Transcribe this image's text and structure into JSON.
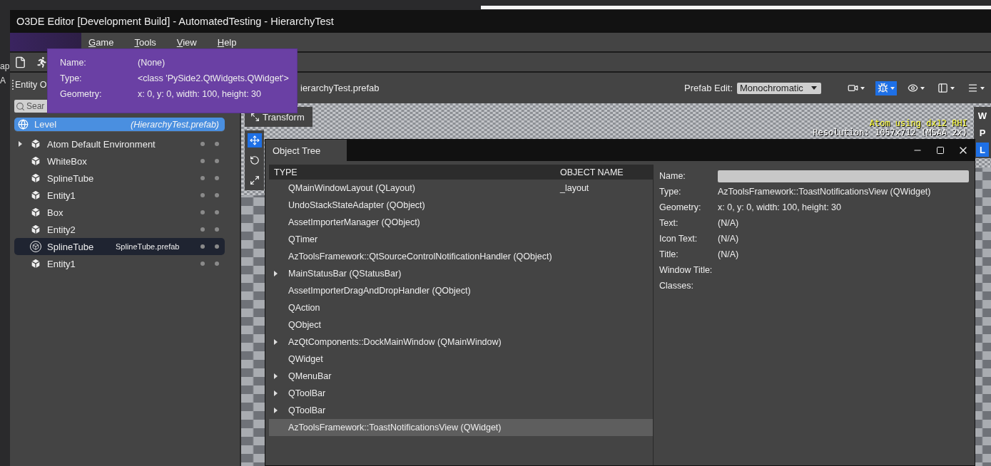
{
  "outside": {
    "fragments": [
      "ap",
      "A"
    ]
  },
  "window": {
    "title": "O3DE Editor [Development Build] - AutomatedTesting - HierarchyTest"
  },
  "menu": [
    {
      "label": "Game"
    },
    {
      "label": "Tools"
    },
    {
      "label": "View"
    },
    {
      "label": "Help"
    }
  ],
  "toolbar": [
    {
      "kind": "file"
    },
    {
      "kind": "run"
    }
  ],
  "tooltip": {
    "rows": [
      {
        "label": "Name:",
        "value": "(None)"
      },
      {
        "label": "Type:",
        "value": "<class 'PySide2.QtWidgets.QWidget'>"
      },
      {
        "label": "Geometry:",
        "value": "x: 0, y: 0, width: 100, height: 30"
      }
    ]
  },
  "outliner": {
    "title": "Entity O",
    "search": {
      "placeholder": "Sear"
    },
    "level": {
      "name": "Level",
      "prefab": "(HierarchyTest.prefab)",
      "selected": true
    },
    "entities": [
      {
        "name": "Atom Default Environment",
        "kind": "entity",
        "expandable": true,
        "highlighted": false
      },
      {
        "name": "WhiteBox",
        "kind": "entity",
        "expandable": false,
        "highlighted": false
      },
      {
        "name": "SplineTube",
        "kind": "entity",
        "expandable": false,
        "highlighted": false
      },
      {
        "name": "Entity1",
        "kind": "entity",
        "expandable": false,
        "highlighted": false
      },
      {
        "name": "Box",
        "kind": "entity",
        "expandable": false,
        "highlighted": false
      },
      {
        "name": "Entity2",
        "kind": "entity",
        "expandable": false,
        "highlighted": false
      },
      {
        "name": "SplineTube",
        "kind": "prefab",
        "prefab": "SplineTube.prefab",
        "expandable": false,
        "highlighted": true
      },
      {
        "name": "Entity1",
        "kind": "entity",
        "expandable": false,
        "highlighted": false
      }
    ]
  },
  "viewport": {
    "tab_title": "ierarchyTest.prefab",
    "prefab_edit": {
      "label": "Prefab Edit:",
      "value": "Monochromatic"
    },
    "toolbar": [
      {
        "kind": "camera",
        "active": false
      },
      {
        "kind": "debug",
        "active": true
      },
      {
        "kind": "visibility",
        "active": false
      },
      {
        "kind": "layout",
        "active": false
      },
      {
        "kind": "menu",
        "active": false
      }
    ],
    "transform_button": "Transform",
    "tools": [
      {
        "kind": "move",
        "selected": true
      },
      {
        "kind": "rotate",
        "selected": false
      },
      {
        "kind": "scale",
        "selected": false
      }
    ],
    "overlay": {
      "renderer": "Atom using dx12 RHI",
      "resolution": "Resolution: 1057x712 (MSAA 2x)"
    },
    "side_buttons": [
      {
        "label": "W",
        "selected": false
      },
      {
        "label": "P",
        "selected": false
      },
      {
        "label": "L",
        "selected": true
      }
    ]
  },
  "object_tree": {
    "title": "Object Tree",
    "columns": [
      "TYPE",
      "OBJECT NAME"
    ],
    "rows": [
      {
        "type": "QMainWindowLayout (QLayout)",
        "object_name": "_layout",
        "expandable": false,
        "selected": false
      },
      {
        "type": "UndoStackStateAdapter (QObject)",
        "expandable": false,
        "selected": false
      },
      {
        "type": "AssetImporterManager (QObject)",
        "expandable": false,
        "selected": false
      },
      {
        "type": "QTimer",
        "expandable": false,
        "selected": false
      },
      {
        "type": "AzToolsFramework::QtSourceControlNotificationHandler (QObject)",
        "expandable": false,
        "selected": false
      },
      {
        "type": "MainStatusBar (QStatusBar)",
        "expandable": true,
        "selected": false
      },
      {
        "type": "AssetImporterDragAndDropHandler (QObject)",
        "expandable": false,
        "selected": false
      },
      {
        "type": "QAction",
        "expandable": false,
        "selected": false
      },
      {
        "type": "QObject",
        "expandable": false,
        "selected": false
      },
      {
        "type": "AzQtComponents::DockMainWindow (QMainWindow)",
        "expandable": true,
        "selected": false
      },
      {
        "type": "QWidget",
        "expandable": false,
        "selected": false
      },
      {
        "type": "QMenuBar",
        "expandable": true,
        "selected": false
      },
      {
        "type": "QToolBar",
        "expandable": true,
        "selected": false
      },
      {
        "type": "QToolBar",
        "expandable": true,
        "selected": false
      },
      {
        "type": "AzToolsFramework::ToastNotificationsView (QWidget)",
        "expandable": false,
        "selected": true
      }
    ],
    "properties": [
      {
        "label": "Name:",
        "kind": "field"
      },
      {
        "label": "Type:",
        "kind": "text",
        "value": "AzToolsFramework::ToastNotificationsView (QWidget)"
      },
      {
        "label": "Geometry:",
        "kind": "text",
        "value": "x: 0, y: 0, width: 100, height: 30"
      },
      {
        "label": "Text:",
        "kind": "text",
        "value": "(N/A)"
      },
      {
        "label": "Icon Text:",
        "kind": "text",
        "value": "(N/A)"
      },
      {
        "label": "Title:",
        "kind": "text",
        "value": "(N/A)"
      },
      {
        "label": "Window Title:",
        "kind": "text"
      },
      {
        "label": "Classes:",
        "kind": "text"
      }
    ]
  }
}
